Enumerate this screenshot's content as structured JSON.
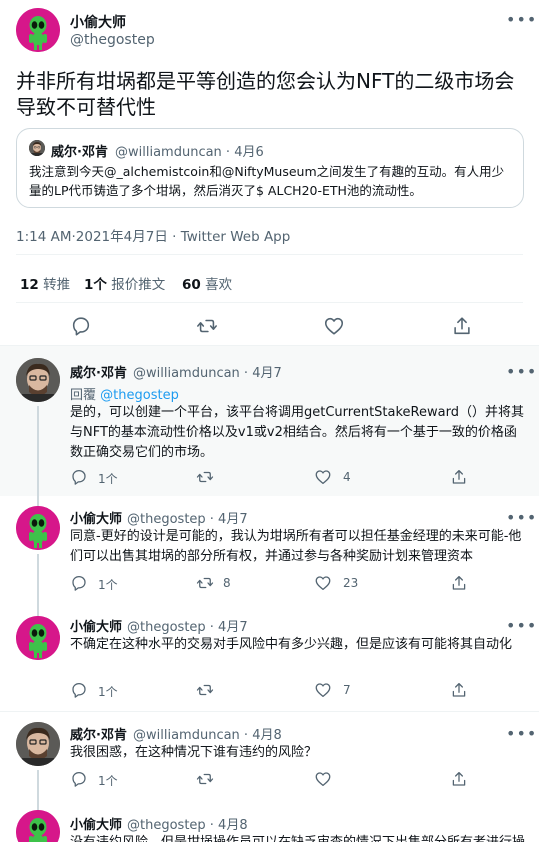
{
  "main": {
    "name": "小偷大师",
    "handle": "@thegostep",
    "text": "并非所有坩埚都是平等创造的您会认为NFT的二级市场会导致不可替代性",
    "quote": {
      "name": "威尔·邓肯",
      "handle": "@williamduncan · 4月6",
      "text": "我注意到今天@_alchemistcoin和@NiftyMuseum之间发生了有趣的互动。有人用少量的LP代币铸造了多个坩埚，然后消灭了$ ALCH20-ETH池的流动性。"
    },
    "meta": "1:14 AM·2021年4月7日 · Twitter Web App",
    "stats": {
      "retweets_count": "12",
      "retweets_label": "转推",
      "quotes_count": "1个",
      "quotes_label": "报价推文",
      "likes_count": "60",
      "likes_label": "喜欢"
    }
  },
  "replies": [
    {
      "name": "威尔·邓肯",
      "meta": "@williamduncan · 4月7",
      "reply_prefix": "回覆",
      "reply_to": "@thegostep",
      "text": "是的，可以创建一个平台，该平台将调用getCurrentStakeReward（）并将其与NFT的基本流动性价格以及v1或v2相结合。然后将有一个基于一致的价格函数正确交易它们的市场。",
      "reply_count": "1个",
      "retweet_count": "",
      "like_count": "4"
    },
    {
      "name": "小偷大师",
      "meta": "@thegostep · 4月7",
      "text": "同意-更好的设计是可能的，我认为坩埚所有者可以担任基金经理的未来可能-他们可以出售其坩埚的部分所有权，并通过参与各种奖励计划来管理资本",
      "reply_count": "1个",
      "retweet_count": "8",
      "like_count": "23"
    },
    {
      "name": "小偷大师",
      "meta": "@thegostep · 4月7",
      "text": "不确定在这种水平的交易对手风险中有多少兴趣，但是应该有可能将其自动化",
      "reply_count": "1个",
      "retweet_count": "",
      "like_count": "7"
    },
    {
      "name": "威尔·邓肯",
      "meta": "@williamduncan · 4月8",
      "text": "我很困惑，在这种情况下谁有违约的风险？",
      "reply_count": "1个",
      "retweet_count": "",
      "like_count": ""
    },
    {
      "name": "小偷大师",
      "meta": "@thegostep · 4月8",
      "text": "没有违约风险，但是坩埚操作员可以在缺乏审查的情况下出售部分所有者进行操",
      "reply_count": "",
      "retweet_count": "",
      "like_count": ""
    }
  ],
  "icons": {
    "more": "more-icon",
    "reply": "reply-icon",
    "retweet": "retweet-icon",
    "like": "heart-icon",
    "share": "share-icon"
  },
  "colors": {
    "accent": "#1d9bf0",
    "avatar_alien": "#d6178a",
    "muted": "#536471"
  }
}
